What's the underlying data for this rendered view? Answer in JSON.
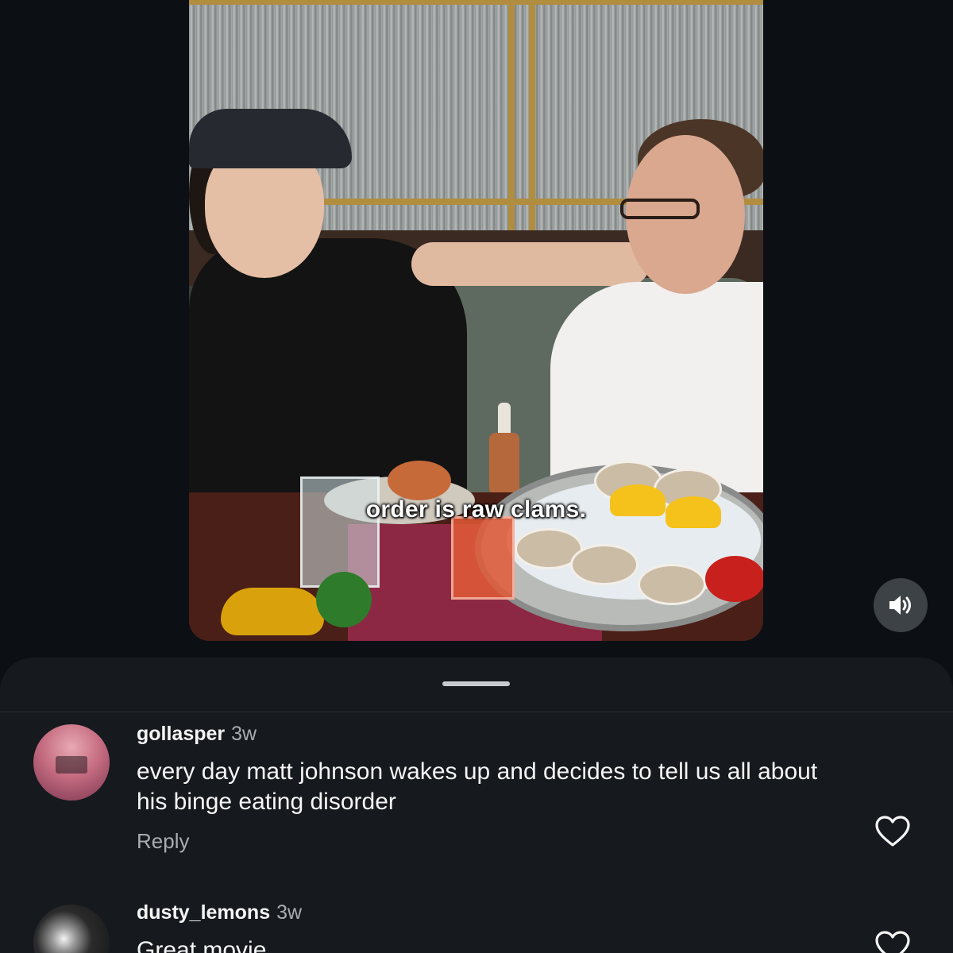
{
  "video": {
    "caption": "order is raw clams."
  },
  "controls": {
    "mute_icon": "speaker-unmuted-icon"
  },
  "comments": [
    {
      "username": "gollasper",
      "time": "3w",
      "text": "every day matt johnson wakes up and decides to tell us all about his binge eating disorder",
      "reply_label": "Reply",
      "like_icon": "heart-outline-icon"
    },
    {
      "username": "dusty_lemons",
      "time": "3w",
      "text": "Great movie",
      "like_icon": "heart-outline-icon"
    }
  ],
  "colors": {
    "background": "#0c1014",
    "sheet": "#16191d",
    "primary_text": "#f5f5f5",
    "secondary_text": "#a8adb3"
  }
}
